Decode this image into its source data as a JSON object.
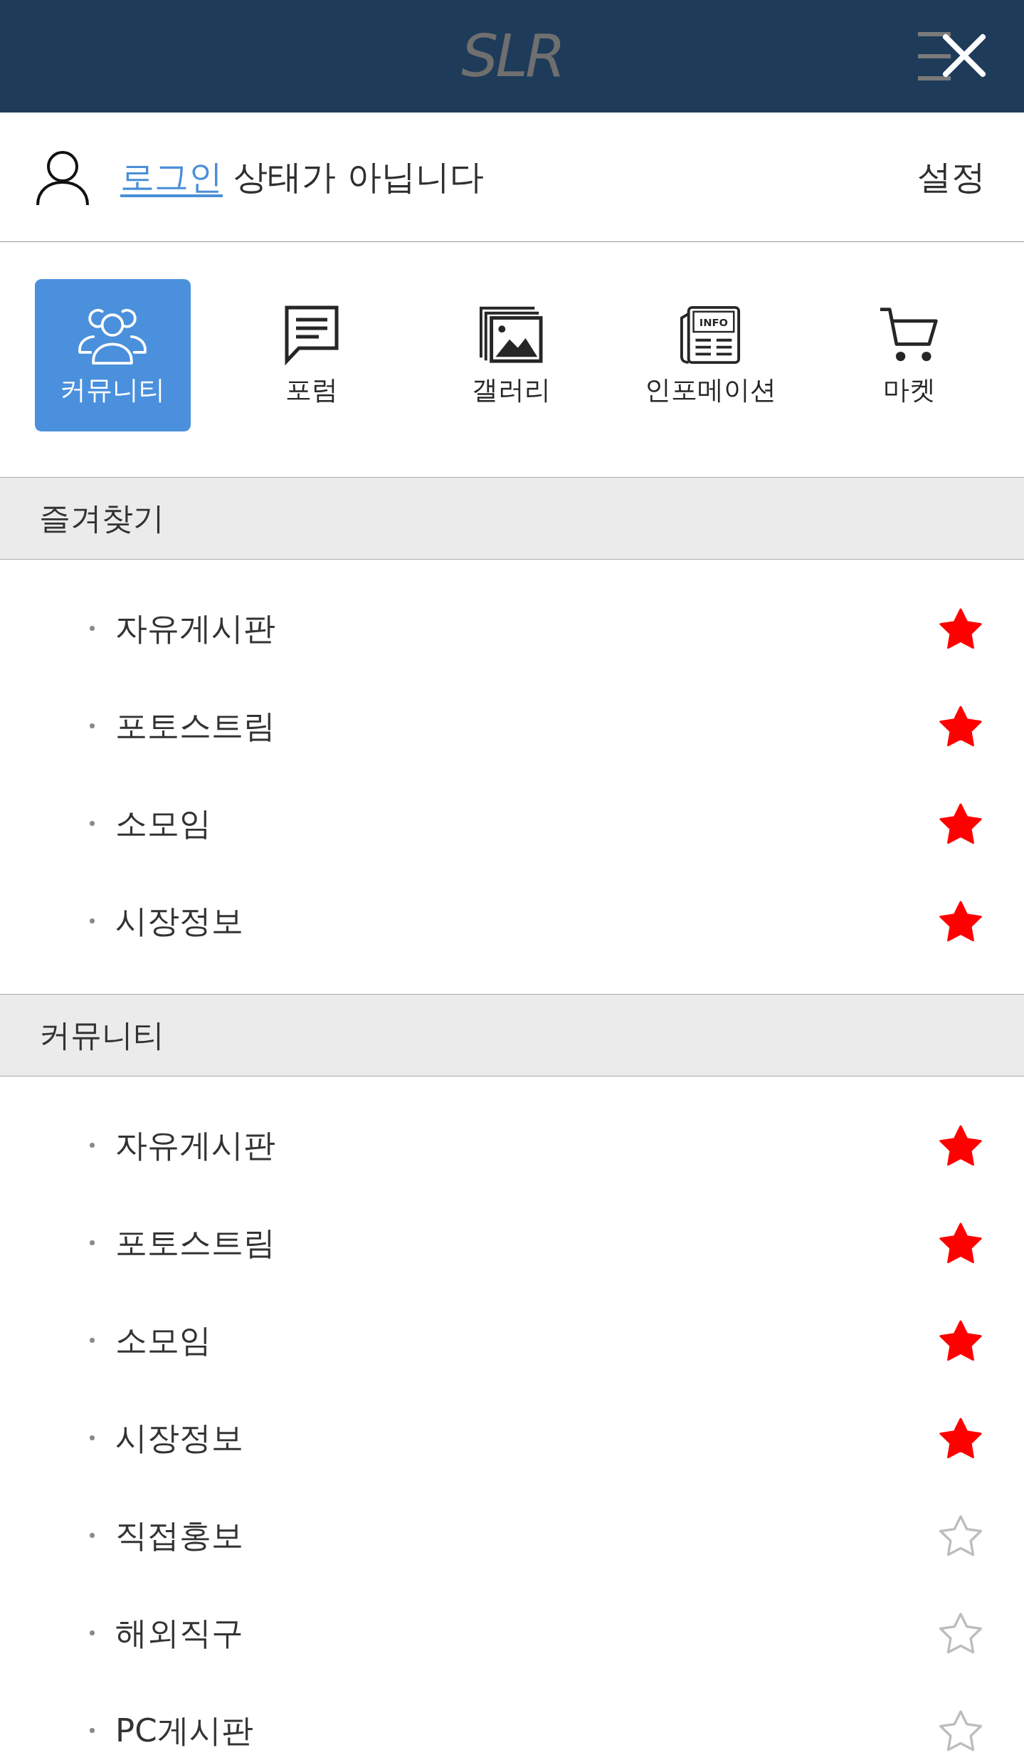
{
  "header": {
    "logo": "SLR"
  },
  "account": {
    "login_link": "로그인",
    "status_text": "상태가 아닙니다",
    "settings": "설정"
  },
  "nav": [
    {
      "label": "커뮤니티",
      "selected": true
    },
    {
      "label": "포럼",
      "selected": false
    },
    {
      "label": "갤러리",
      "selected": false
    },
    {
      "label": "인포메이션",
      "selected": false,
      "icon_text": "INFO"
    },
    {
      "label": "마켓",
      "selected": false
    }
  ],
  "sections": [
    {
      "title": "즐겨찾기",
      "items": [
        {
          "label": "자유게시판",
          "favorite": true
        },
        {
          "label": "포토스트림",
          "favorite": true
        },
        {
          "label": "소모임",
          "favorite": true
        },
        {
          "label": "시장정보",
          "favorite": true
        }
      ]
    },
    {
      "title": "커뮤니티",
      "items": [
        {
          "label": "자유게시판",
          "favorite": true
        },
        {
          "label": "포토스트림",
          "favorite": true
        },
        {
          "label": "소모임",
          "favorite": true
        },
        {
          "label": "시장정보",
          "favorite": true
        },
        {
          "label": "직접홍보",
          "favorite": false
        },
        {
          "label": "해외직구",
          "favorite": false
        },
        {
          "label": "PC게시판",
          "favorite": false
        }
      ]
    }
  ]
}
